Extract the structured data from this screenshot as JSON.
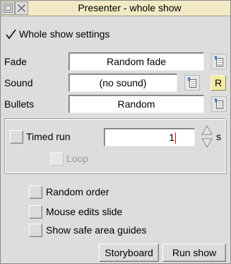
{
  "window": {
    "title": "Presenter - whole show"
  },
  "whole_show": {
    "label": "Whole show settings",
    "checked": true
  },
  "settings": {
    "fade_label": "Fade",
    "fade_value": "Random fade",
    "sound_label": "Sound",
    "sound_value": "(no sound)",
    "sound_r_button": "R",
    "bullets_label": "Bullets",
    "bullets_value": "Random"
  },
  "timed": {
    "label": "Timed run",
    "value": "1",
    "unit": "s",
    "loop_label": "Loop"
  },
  "options": {
    "random_order": "Random order",
    "mouse_edits": "Mouse edits slide",
    "safe_area": "Show safe area guides"
  },
  "actions": {
    "storyboard": "Storyboard",
    "run_show": "Run show"
  },
  "colors": {
    "titlebar": "#f2eac4",
    "window_bg": "#dddddd",
    "r_button": "#f3eca4",
    "caret": "#d40000"
  },
  "icons": {
    "titlebar_left": "back-icon",
    "titlebar_close": "close-icon",
    "menu": "popup-menu-icon",
    "stepper": "up-down-arrows-icon",
    "tick": "tick-icon"
  }
}
